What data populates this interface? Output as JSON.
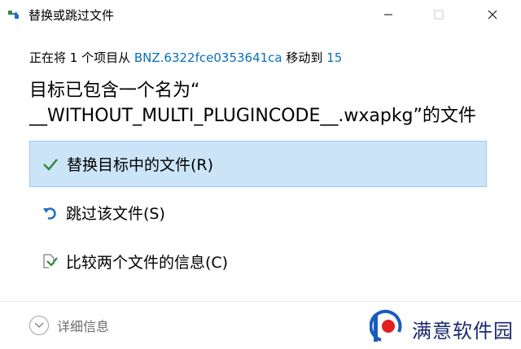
{
  "window": {
    "title": "替换或跳过文件"
  },
  "status": {
    "prefix": "正在将 1 个项目从",
    "source": "BNZ.6322fce0353641ca",
    "middle": "移动到",
    "destination": "15"
  },
  "message": {
    "line1": "目标已包含一个名为“",
    "line2": "__WITHOUT_MULTI_PLUGINCODE__.wxapkg”的文件"
  },
  "options": [
    {
      "label": "替换目标中的文件(R)",
      "icon": "checkmark-icon",
      "selected": true
    },
    {
      "label": "跳过该文件(S)",
      "icon": "undo-arrow-icon",
      "selected": false
    },
    {
      "label": "比较两个文件的信息(C)",
      "icon": "compare-files-icon",
      "selected": false
    }
  ],
  "footer": {
    "details_label": "详细信息"
  },
  "watermark": {
    "text": "满意软件园"
  },
  "colors": {
    "accent_link": "#0a6fb8",
    "selected_bg": "#cce4f7",
    "selected_border": "#99c9ef",
    "check_green": "#2e8b3a",
    "undo_blue": "#1e6fc7"
  }
}
